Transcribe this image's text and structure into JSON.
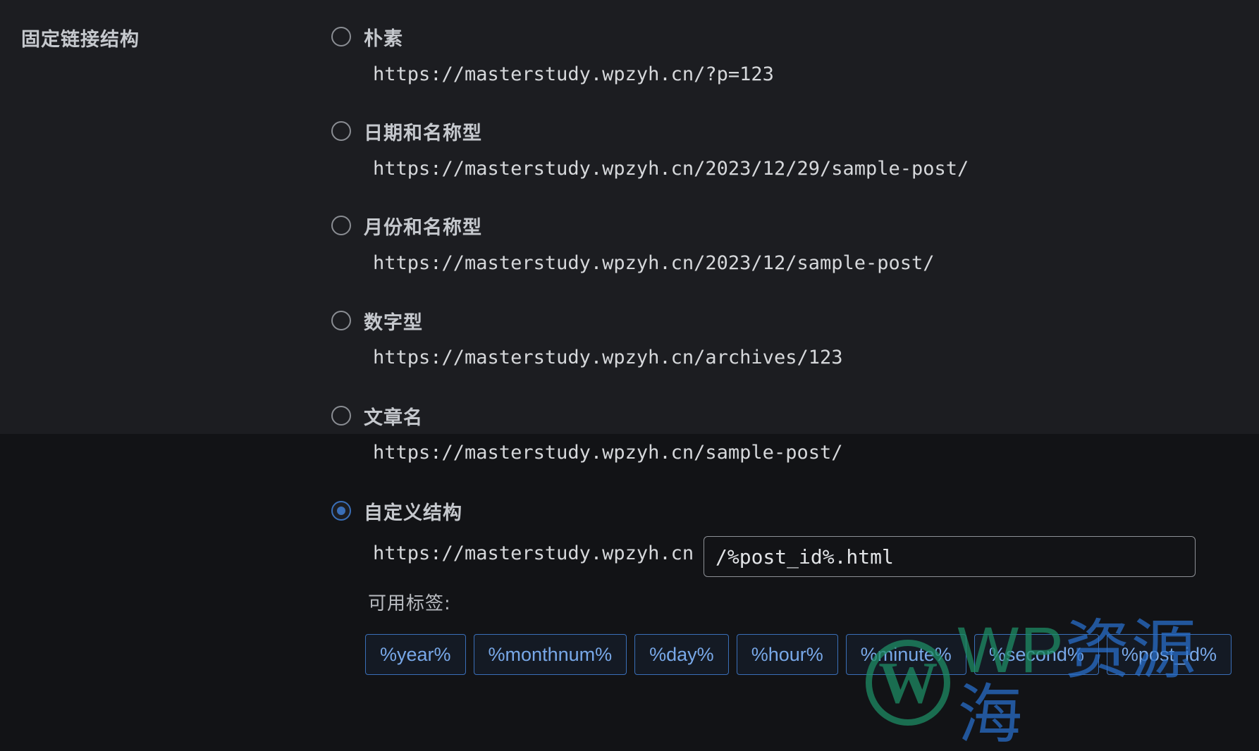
{
  "section": {
    "label": "固定链接结构"
  },
  "options": [
    {
      "label": "朴素",
      "example": "https://masterstudy.wpzyh.cn/?p=123",
      "checked": false
    },
    {
      "label": "日期和名称型",
      "example": "https://masterstudy.wpzyh.cn/2023/12/29/sample-post/",
      "checked": false
    },
    {
      "label": "月份和名称型",
      "example": "https://masterstudy.wpzyh.cn/2023/12/sample-post/",
      "checked": false
    },
    {
      "label": "数字型",
      "example": "https://masterstudy.wpzyh.cn/archives/123",
      "checked": false
    },
    {
      "label": "文章名",
      "example": "https://masterstudy.wpzyh.cn/sample-post/",
      "checked": false
    },
    {
      "label": "自定义结构",
      "checked": true
    }
  ],
  "custom": {
    "prefix": "https://masterstudy.wpzyh.cn",
    "value": "/%post_id%.html"
  },
  "tags": {
    "label": "可用标签:",
    "items": [
      "%year%",
      "%monthnum%",
      "%day%",
      "%hour%",
      "%minute%",
      "%second%",
      "%post_id%"
    ]
  },
  "watermark": {
    "logo_letter": "W",
    "text_latin": "WP",
    "text_cn": "资源海"
  },
  "colors": {
    "accent": "#3a6fb8",
    "tag_text": "#78a8e8",
    "watermark_green": "#1e8c64"
  }
}
